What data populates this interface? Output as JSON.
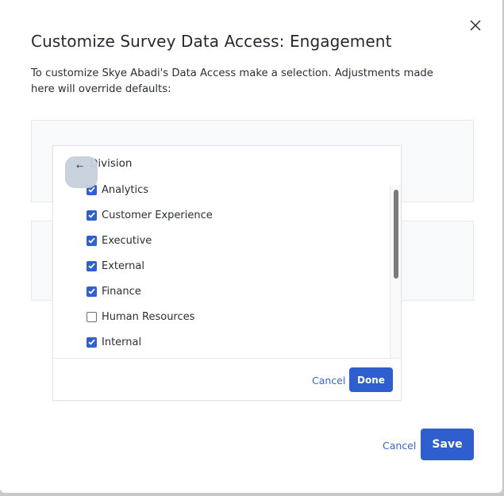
{
  "modal": {
    "title": "Customize Survey Data Access: Engagement",
    "description": "To customize Skye Abadi's Data Access make a selection. Adjustments made here will override defaults:",
    "close_icon": "close-x-icon",
    "cancel_label": "Cancel",
    "save_label": "Save"
  },
  "popover": {
    "title": "Division",
    "back_icon": "arrow-left-icon",
    "back_glyph": "←",
    "options": [
      {
        "label": "Analytics",
        "checked": true
      },
      {
        "label": "Customer Experience",
        "checked": true
      },
      {
        "label": "Executive",
        "checked": true
      },
      {
        "label": "External",
        "checked": true
      },
      {
        "label": "Finance",
        "checked": true
      },
      {
        "label": "Human Resources",
        "checked": false
      },
      {
        "label": "Internal",
        "checked": true
      }
    ],
    "cancel_label": "Cancel",
    "done_label": "Done"
  },
  "colors": {
    "accent": "#2f5fcf",
    "link": "#3a66cc",
    "checkbox_checked": "#3060d0"
  }
}
